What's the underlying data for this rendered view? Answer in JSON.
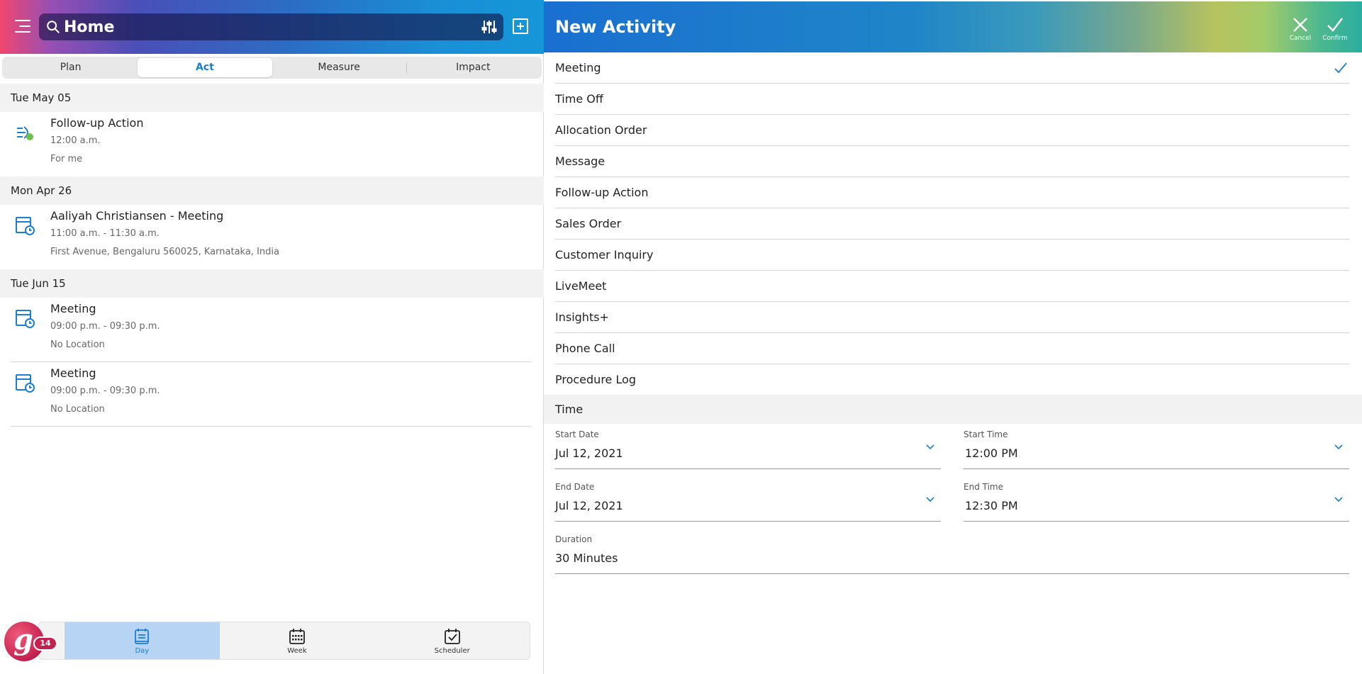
{
  "colors": {
    "accent": "#1a7fd3",
    "brand": "#c4214f"
  },
  "header": {
    "search_text": "Home"
  },
  "tabs": [
    {
      "label": "Plan",
      "active": false
    },
    {
      "label": "Act",
      "active": true
    },
    {
      "label": "Measure",
      "active": false
    },
    {
      "label": "Impact",
      "active": false
    }
  ],
  "groups": [
    {
      "date": "Tue May 05",
      "items": [
        {
          "icon": "follow-up-icon",
          "title": "Follow-up Action",
          "time": "12:00 a.m.",
          "detail": "For me"
        }
      ]
    },
    {
      "date": "Mon Apr 26",
      "items": [
        {
          "icon": "meeting-icon",
          "title": "Aaliyah Christiansen - Meeting",
          "time": "11:00 a.m. - 11:30 a.m.",
          "detail": "First Avenue, Bengaluru 560025, Karnataka, India"
        }
      ]
    },
    {
      "date": "Tue Jun 15",
      "items": [
        {
          "icon": "meeting-icon",
          "title": "Meeting",
          "time": "09:00 p.m. - 09:30 p.m.",
          "detail": "No Location"
        },
        {
          "icon": "meeting-icon",
          "title": "Meeting",
          "time": "09:00 p.m. - 09:30 p.m.",
          "detail": "No Location"
        }
      ]
    }
  ],
  "bottom_nav": [
    {
      "label": "Day",
      "icon": "day-icon",
      "active": true
    },
    {
      "label": "Week",
      "icon": "week-icon",
      "active": false
    },
    {
      "label": "Scheduler",
      "icon": "scheduler-icon",
      "active": false
    }
  ],
  "badge_count": "14",
  "panel": {
    "title": "New Activity",
    "cancel_label": "Cancel",
    "confirm_label": "Confirm",
    "activity_types": [
      "Meeting",
      "Time Off",
      "Allocation Order",
      "Message",
      "Follow-up Action",
      "Sales Order",
      "Customer Inquiry",
      "LiveMeet",
      "Insights+",
      "Phone Call",
      "Procedure Log"
    ],
    "selected_type": "Meeting",
    "time_section": "Time",
    "start_date_label": "Start Date",
    "start_date": "Jul 12, 2021",
    "start_time_label": "Start Time",
    "start_time": "12:00 PM",
    "end_date_label": "End Date",
    "end_date": "Jul 12, 2021",
    "end_time_label": "End Time",
    "end_time": "12:30 PM",
    "duration_label": "Duration",
    "duration": "30 Minutes"
  }
}
